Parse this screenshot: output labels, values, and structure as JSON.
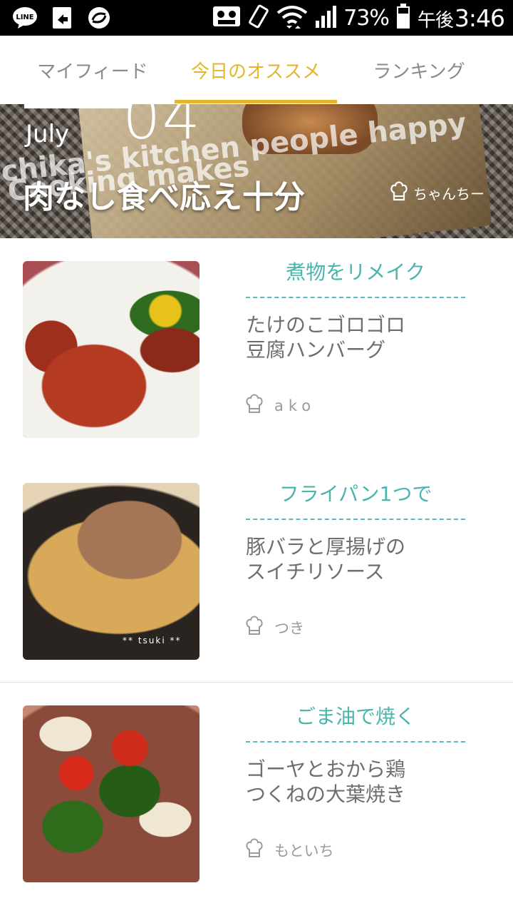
{
  "status_bar": {
    "battery_percent": "73%",
    "ampm": "午後",
    "time": "3:46",
    "icons": [
      "line-icon",
      "share-icon",
      "sync-icon",
      "cassette-icon",
      "vibrate-icon",
      "wifi-icon",
      "signal-icon",
      "battery-icon"
    ]
  },
  "tabs": [
    {
      "label": "マイフィード",
      "active": false
    },
    {
      "label": "今日のオススメ",
      "active": true
    },
    {
      "label": "ランキング",
      "active": false
    }
  ],
  "accent_color": "#e6b62a",
  "category_color": "#4ab4ad",
  "banner": {
    "month": "July",
    "day": "04",
    "watermark_line1": "chika's kitchen  people happy",
    "watermark_line2": "Cooking makes",
    "headline": "肉なし食べ応え十分",
    "author": "ちゃんちー"
  },
  "recipes": [
    {
      "category": "煮物をリメイク",
      "title_line1": "たけのこゴロゴロ",
      "title_line2": "豆腐ハンバーグ",
      "author": "ako",
      "image": "hamburg-steak-photo"
    },
    {
      "category": "フライパン1つで",
      "title_line1": "豚バラと厚揚げの",
      "title_line2": "スイチリソース",
      "author": "つき",
      "image": "pork-tofu-photo",
      "image_watermark": "** tsuki **"
    },
    {
      "category": "ごま油で焼く",
      "title_line1": "ゴーヤとおから鶏",
      "title_line2": "つくねの大葉焼き",
      "author": "もといち",
      "image": "goya-tsukune-photo"
    }
  ]
}
